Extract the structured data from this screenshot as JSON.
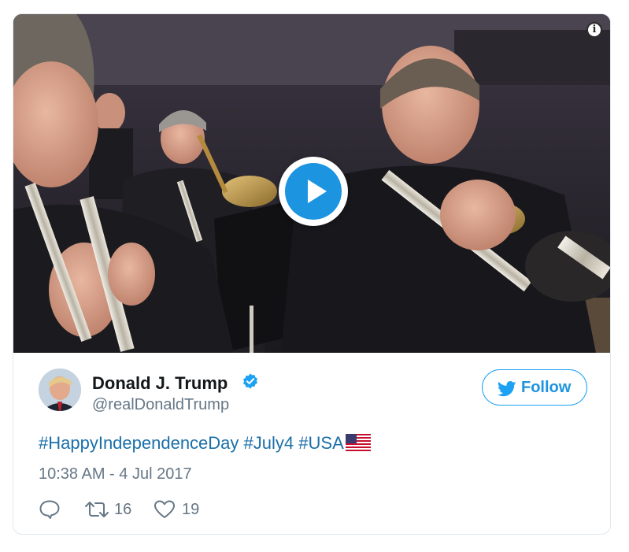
{
  "tweet": {
    "author_name": "Donald J. Trump",
    "handle": "@realDonaldTrump",
    "follow_label": "Follow",
    "hashtags": [
      "#HappyIndependenceDay",
      "#July4",
      "#USA"
    ],
    "timestamp": "10:38 AM - 4 Jul 2017",
    "retweet_count": "16",
    "like_count": "19"
  },
  "media": {
    "type": "video",
    "description_icons": [
      "play-icon",
      "info-icon"
    ]
  },
  "colors": {
    "accent": "#1da1f2",
    "hashtag": "#1b6fa8",
    "secondary_text": "#657786",
    "border": "#e1e8ed"
  }
}
